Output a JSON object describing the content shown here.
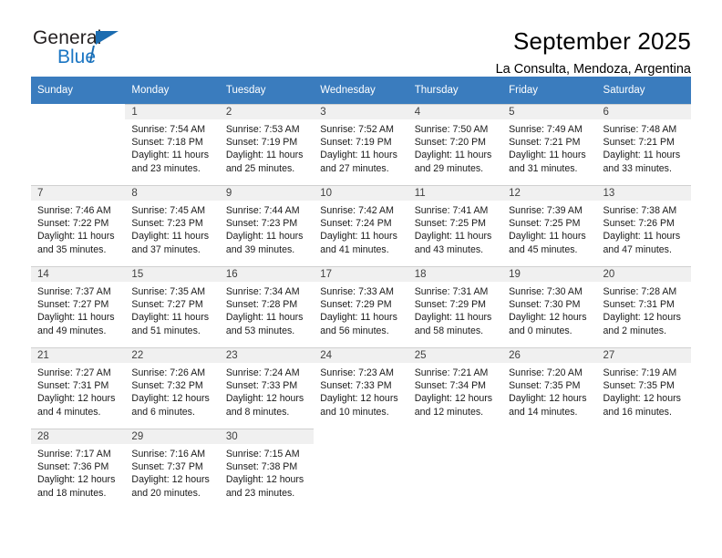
{
  "brand": {
    "name_part1": "General",
    "name_part2": "Blue",
    "triangle_icon": "brand-triangle-icon",
    "accent_color": "#1b6cb0"
  },
  "header": {
    "title": "September 2025",
    "subtitle": "La Consulta, Mendoza, Argentina"
  },
  "calendar": {
    "header_bg": "#3a7cbe",
    "daynum_bg": "#f0f0f0",
    "weekdays": [
      "Sunday",
      "Monday",
      "Tuesday",
      "Wednesday",
      "Thursday",
      "Friday",
      "Saturday"
    ],
    "weeks": [
      [
        {
          "day": "",
          "sunrise": "",
          "sunset": "",
          "daylight1": "",
          "daylight2": ""
        },
        {
          "day": "1",
          "sunrise": "Sunrise: 7:54 AM",
          "sunset": "Sunset: 7:18 PM",
          "daylight1": "Daylight: 11 hours",
          "daylight2": "and 23 minutes."
        },
        {
          "day": "2",
          "sunrise": "Sunrise: 7:53 AM",
          "sunset": "Sunset: 7:19 PM",
          "daylight1": "Daylight: 11 hours",
          "daylight2": "and 25 minutes."
        },
        {
          "day": "3",
          "sunrise": "Sunrise: 7:52 AM",
          "sunset": "Sunset: 7:19 PM",
          "daylight1": "Daylight: 11 hours",
          "daylight2": "and 27 minutes."
        },
        {
          "day": "4",
          "sunrise": "Sunrise: 7:50 AM",
          "sunset": "Sunset: 7:20 PM",
          "daylight1": "Daylight: 11 hours",
          "daylight2": "and 29 minutes."
        },
        {
          "day": "5",
          "sunrise": "Sunrise: 7:49 AM",
          "sunset": "Sunset: 7:21 PM",
          "daylight1": "Daylight: 11 hours",
          "daylight2": "and 31 minutes."
        },
        {
          "day": "6",
          "sunrise": "Sunrise: 7:48 AM",
          "sunset": "Sunset: 7:21 PM",
          "daylight1": "Daylight: 11 hours",
          "daylight2": "and 33 minutes."
        }
      ],
      [
        {
          "day": "7",
          "sunrise": "Sunrise: 7:46 AM",
          "sunset": "Sunset: 7:22 PM",
          "daylight1": "Daylight: 11 hours",
          "daylight2": "and 35 minutes."
        },
        {
          "day": "8",
          "sunrise": "Sunrise: 7:45 AM",
          "sunset": "Sunset: 7:23 PM",
          "daylight1": "Daylight: 11 hours",
          "daylight2": "and 37 minutes."
        },
        {
          "day": "9",
          "sunrise": "Sunrise: 7:44 AM",
          "sunset": "Sunset: 7:23 PM",
          "daylight1": "Daylight: 11 hours",
          "daylight2": "and 39 minutes."
        },
        {
          "day": "10",
          "sunrise": "Sunrise: 7:42 AM",
          "sunset": "Sunset: 7:24 PM",
          "daylight1": "Daylight: 11 hours",
          "daylight2": "and 41 minutes."
        },
        {
          "day": "11",
          "sunrise": "Sunrise: 7:41 AM",
          "sunset": "Sunset: 7:25 PM",
          "daylight1": "Daylight: 11 hours",
          "daylight2": "and 43 minutes."
        },
        {
          "day": "12",
          "sunrise": "Sunrise: 7:39 AM",
          "sunset": "Sunset: 7:25 PM",
          "daylight1": "Daylight: 11 hours",
          "daylight2": "and 45 minutes."
        },
        {
          "day": "13",
          "sunrise": "Sunrise: 7:38 AM",
          "sunset": "Sunset: 7:26 PM",
          "daylight1": "Daylight: 11 hours",
          "daylight2": "and 47 minutes."
        }
      ],
      [
        {
          "day": "14",
          "sunrise": "Sunrise: 7:37 AM",
          "sunset": "Sunset: 7:27 PM",
          "daylight1": "Daylight: 11 hours",
          "daylight2": "and 49 minutes."
        },
        {
          "day": "15",
          "sunrise": "Sunrise: 7:35 AM",
          "sunset": "Sunset: 7:27 PM",
          "daylight1": "Daylight: 11 hours",
          "daylight2": "and 51 minutes."
        },
        {
          "day": "16",
          "sunrise": "Sunrise: 7:34 AM",
          "sunset": "Sunset: 7:28 PM",
          "daylight1": "Daylight: 11 hours",
          "daylight2": "and 53 minutes."
        },
        {
          "day": "17",
          "sunrise": "Sunrise: 7:33 AM",
          "sunset": "Sunset: 7:29 PM",
          "daylight1": "Daylight: 11 hours",
          "daylight2": "and 56 minutes."
        },
        {
          "day": "18",
          "sunrise": "Sunrise: 7:31 AM",
          "sunset": "Sunset: 7:29 PM",
          "daylight1": "Daylight: 11 hours",
          "daylight2": "and 58 minutes."
        },
        {
          "day": "19",
          "sunrise": "Sunrise: 7:30 AM",
          "sunset": "Sunset: 7:30 PM",
          "daylight1": "Daylight: 12 hours",
          "daylight2": "and 0 minutes."
        },
        {
          "day": "20",
          "sunrise": "Sunrise: 7:28 AM",
          "sunset": "Sunset: 7:31 PM",
          "daylight1": "Daylight: 12 hours",
          "daylight2": "and 2 minutes."
        }
      ],
      [
        {
          "day": "21",
          "sunrise": "Sunrise: 7:27 AM",
          "sunset": "Sunset: 7:31 PM",
          "daylight1": "Daylight: 12 hours",
          "daylight2": "and 4 minutes."
        },
        {
          "day": "22",
          "sunrise": "Sunrise: 7:26 AM",
          "sunset": "Sunset: 7:32 PM",
          "daylight1": "Daylight: 12 hours",
          "daylight2": "and 6 minutes."
        },
        {
          "day": "23",
          "sunrise": "Sunrise: 7:24 AM",
          "sunset": "Sunset: 7:33 PM",
          "daylight1": "Daylight: 12 hours",
          "daylight2": "and 8 minutes."
        },
        {
          "day": "24",
          "sunrise": "Sunrise: 7:23 AM",
          "sunset": "Sunset: 7:33 PM",
          "daylight1": "Daylight: 12 hours",
          "daylight2": "and 10 minutes."
        },
        {
          "day": "25",
          "sunrise": "Sunrise: 7:21 AM",
          "sunset": "Sunset: 7:34 PM",
          "daylight1": "Daylight: 12 hours",
          "daylight2": "and 12 minutes."
        },
        {
          "day": "26",
          "sunrise": "Sunrise: 7:20 AM",
          "sunset": "Sunset: 7:35 PM",
          "daylight1": "Daylight: 12 hours",
          "daylight2": "and 14 minutes."
        },
        {
          "day": "27",
          "sunrise": "Sunrise: 7:19 AM",
          "sunset": "Sunset: 7:35 PM",
          "daylight1": "Daylight: 12 hours",
          "daylight2": "and 16 minutes."
        }
      ],
      [
        {
          "day": "28",
          "sunrise": "Sunrise: 7:17 AM",
          "sunset": "Sunset: 7:36 PM",
          "daylight1": "Daylight: 12 hours",
          "daylight2": "and 18 minutes."
        },
        {
          "day": "29",
          "sunrise": "Sunrise: 7:16 AM",
          "sunset": "Sunset: 7:37 PM",
          "daylight1": "Daylight: 12 hours",
          "daylight2": "and 20 minutes."
        },
        {
          "day": "30",
          "sunrise": "Sunrise: 7:15 AM",
          "sunset": "Sunset: 7:38 PM",
          "daylight1": "Daylight: 12 hours",
          "daylight2": "and 23 minutes."
        },
        {
          "day": "",
          "sunrise": "",
          "sunset": "",
          "daylight1": "",
          "daylight2": ""
        },
        {
          "day": "",
          "sunrise": "",
          "sunset": "",
          "daylight1": "",
          "daylight2": ""
        },
        {
          "day": "",
          "sunrise": "",
          "sunset": "",
          "daylight1": "",
          "daylight2": ""
        },
        {
          "day": "",
          "sunrise": "",
          "sunset": "",
          "daylight1": "",
          "daylight2": ""
        }
      ]
    ]
  }
}
